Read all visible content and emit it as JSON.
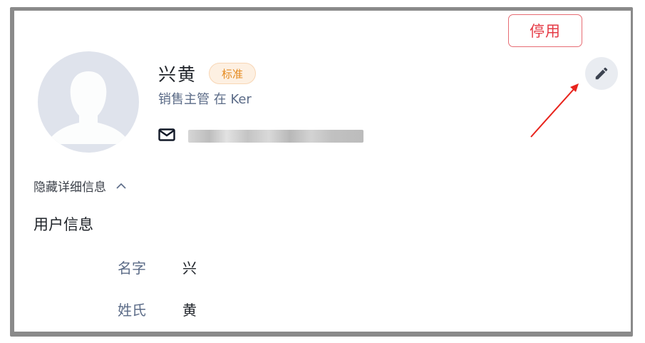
{
  "header": {
    "disable_label": "停用",
    "edit_icon": "pencil-icon"
  },
  "profile": {
    "name": "兴黄",
    "badge": "标准",
    "subtitle": "销售主管 在 Ker",
    "email_icon": "mail-icon",
    "avatar_icon": "default-avatar-silhouette"
  },
  "details": {
    "toggle_label": "隐藏详细信息",
    "toggle_icon": "chevron-up-icon"
  },
  "user_info": {
    "title": "用户信息",
    "fields": [
      {
        "label": "名字",
        "value": "兴"
      },
      {
        "label": "姓氏",
        "value": "黄"
      }
    ]
  },
  "annotation": {
    "arrow_color": "#e8231c"
  }
}
